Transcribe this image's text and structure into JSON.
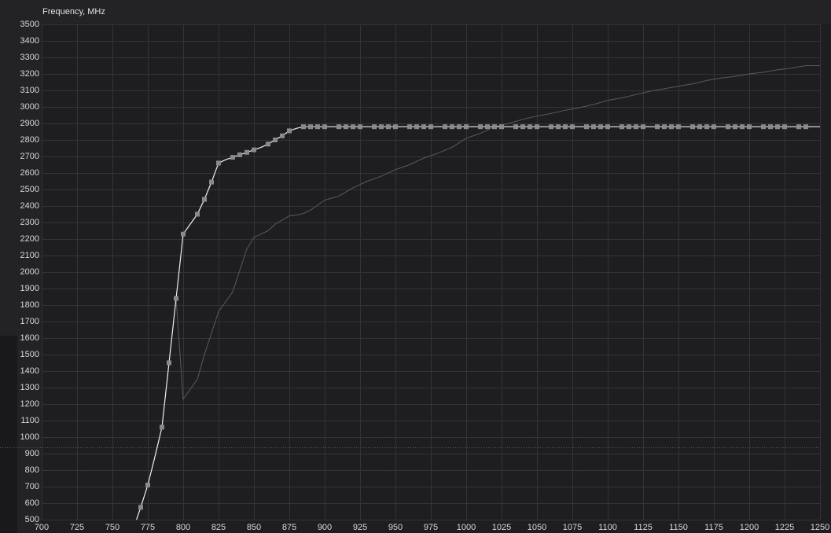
{
  "chart_data": {
    "type": "line",
    "ylabel": "Frequency, MHz",
    "xlim": [
      700,
      1250
    ],
    "ylim": [
      500,
      3500
    ],
    "x_ticks": [
      700,
      725,
      750,
      775,
      800,
      825,
      850,
      875,
      900,
      925,
      950,
      975,
      1000,
      1025,
      1050,
      1075,
      1100,
      1125,
      1150,
      1175,
      1200,
      1225,
      1250
    ],
    "y_ticks": [
      500,
      600,
      700,
      800,
      900,
      1000,
      1100,
      1200,
      1300,
      1400,
      1500,
      1600,
      1700,
      1800,
      1900,
      2000,
      2100,
      2200,
      2300,
      2400,
      2500,
      2600,
      2700,
      2800,
      2900,
      3000,
      3100,
      3200,
      3300,
      3400,
      3500
    ],
    "grid": true,
    "reference_line": {
      "y": 940,
      "style": "dotted"
    },
    "series": [
      {
        "color": "#f0f0f0",
        "marker_color": "#8a8a8a",
        "markers": true,
        "x": [
          767,
          770,
          775,
          780,
          785,
          790,
          795,
          800,
          805,
          810,
          815,
          820,
          825,
          830,
          835,
          840,
          845,
          850,
          855,
          860,
          865,
          870,
          875,
          880,
          885,
          890,
          895,
          900,
          910,
          915,
          920,
          925,
          935,
          940,
          945,
          950,
          960,
          965,
          970,
          975,
          985,
          990,
          995,
          1000,
          1010,
          1015,
          1020,
          1025,
          1035,
          1040,
          1045,
          1050,
          1060,
          1065,
          1070,
          1075,
          1085,
          1090,
          1095,
          1100,
          1110,
          1115,
          1120,
          1125,
          1135,
          1140,
          1145,
          1150,
          1160,
          1165,
          1170,
          1175,
          1185,
          1190,
          1195,
          1200,
          1210,
          1215,
          1220,
          1225,
          1235,
          1240,
          1250
        ],
        "y": [
          500,
          575,
          710,
          880,
          1060,
          1450,
          1840,
          2230,
          2290,
          2350,
          2440,
          2545,
          2660,
          2680,
          2695,
          2710,
          2725,
          2740,
          2755,
          2775,
          2800,
          2825,
          2855,
          2870,
          2880,
          2880,
          2880,
          2880,
          2880,
          2880,
          2880,
          2880,
          2880,
          2880,
          2880,
          2880,
          2880,
          2880,
          2880,
          2880,
          2880,
          2880,
          2880,
          2880,
          2880,
          2880,
          2880,
          2880,
          2880,
          2880,
          2880,
          2880,
          2880,
          2880,
          2880,
          2880,
          2880,
          2880,
          2880,
          2880,
          2880,
          2880,
          2880,
          2880,
          2880,
          2880,
          2880,
          2880,
          2880,
          2880,
          2880,
          2880,
          2880,
          2880,
          2880,
          2880,
          2880,
          2880,
          2880,
          2880,
          2880,
          2880,
          2880
        ],
        "marker_x": [
          770,
          775,
          785,
          790,
          795,
          800,
          810,
          815,
          820,
          825,
          835,
          840,
          845,
          850,
          860,
          865,
          870,
          875,
          885,
          890,
          895,
          900,
          910,
          915,
          920,
          925,
          935,
          940,
          945,
          950,
          960,
          965,
          970,
          975,
          985,
          990,
          995,
          1000,
          1010,
          1015,
          1020,
          1025,
          1035,
          1040,
          1045,
          1050,
          1060,
          1065,
          1070,
          1075,
          1085,
          1090,
          1095,
          1100,
          1110,
          1115,
          1120,
          1125,
          1135,
          1140,
          1145,
          1150,
          1160,
          1165,
          1170,
          1175,
          1185,
          1190,
          1195,
          1200,
          1210,
          1215,
          1220,
          1225,
          1235,
          1240
        ]
      },
      {
        "color": "#5a5a5e",
        "markers": false,
        "x": [
          795,
          800,
          805,
          810,
          815,
          820,
          825,
          830,
          835,
          840,
          845,
          850,
          855,
          860,
          865,
          870,
          875,
          880,
          885,
          890,
          895,
          900,
          910,
          920,
          930,
          940,
          950,
          960,
          970,
          980,
          990,
          1000,
          1010,
          1020,
          1030,
          1040,
          1050,
          1060,
          1070,
          1080,
          1090,
          1100,
          1110,
          1120,
          1130,
          1140,
          1150,
          1160,
          1170,
          1180,
          1190,
          1200,
          1210,
          1220,
          1230,
          1240,
          1250
        ],
        "y": [
          1840,
          1230,
          1290,
          1350,
          1500,
          1630,
          1760,
          1820,
          1880,
          2010,
          2140,
          2210,
          2230,
          2250,
          2290,
          2315,
          2340,
          2345,
          2355,
          2375,
          2405,
          2435,
          2460,
          2510,
          2550,
          2580,
          2620,
          2650,
          2690,
          2720,
          2755,
          2810,
          2840,
          2880,
          2900,
          2925,
          2945,
          2960,
          2980,
          2995,
          3015,
          3040,
          3055,
          3075,
          3095,
          3110,
          3125,
          3140,
          3160,
          3175,
          3185,
          3200,
          3210,
          3225,
          3235,
          3250,
          3250
        ]
      }
    ]
  }
}
